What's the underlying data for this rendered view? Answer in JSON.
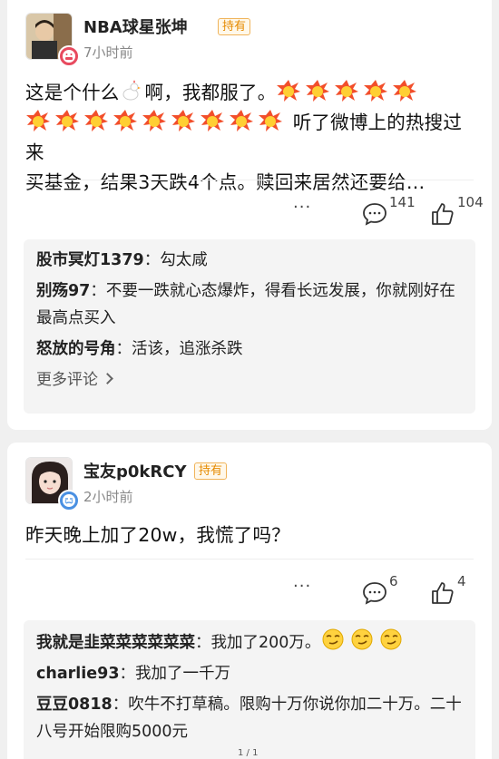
{
  "posts": [
    {
      "username": "NBA球星张坤",
      "tag": "持有",
      "time": "7小时前",
      "text_1": "这是个什么",
      "text_2": "啊，我都服了。",
      "text_3": " 听了微博上的热搜过来",
      "text_4": "买基金，结果3天跌4个点。赎回来居然还要给…",
      "comments_count": "141",
      "likes_count": "104",
      "more": "···",
      "comments": [
        {
          "user": "股市冥灯1379",
          "sep": "：",
          "text": "勾太咸"
        },
        {
          "user": "别殇97",
          "sep": "：",
          "text": "不要一跌就心态爆炸，得看长远发展，你就刚好在最高点买入"
        },
        {
          "user": "怒放的号角",
          "sep": "：",
          "text": "活该，追涨杀跌"
        }
      ],
      "more_comments": "更多评论"
    },
    {
      "username": "宝友p0kRCY",
      "tag": "持有",
      "time": "2小时前",
      "text": "昨天晚上加了20w，我慌了吗？",
      "comments_count": "6",
      "likes_count": "4",
      "more": "···",
      "comments": [
        {
          "user": "我就是韭菜菜菜菜菜菜",
          "sep": "：",
          "text": "我加了200万。"
        },
        {
          "user": "charlie93",
          "sep": "：",
          "text": "我加了一千万"
        },
        {
          "user": "豆豆0818",
          "sep": "：",
          "text": "吹牛不打草稿。限购十万你说你加二十万。二十八号开始限购5000元"
        }
      ]
    }
  ],
  "page_indicator": "1 / 1",
  "colors": {
    "tag": "#e68a00",
    "badge_red": "#e84a5f",
    "badge_blue": "#4a90e2"
  }
}
